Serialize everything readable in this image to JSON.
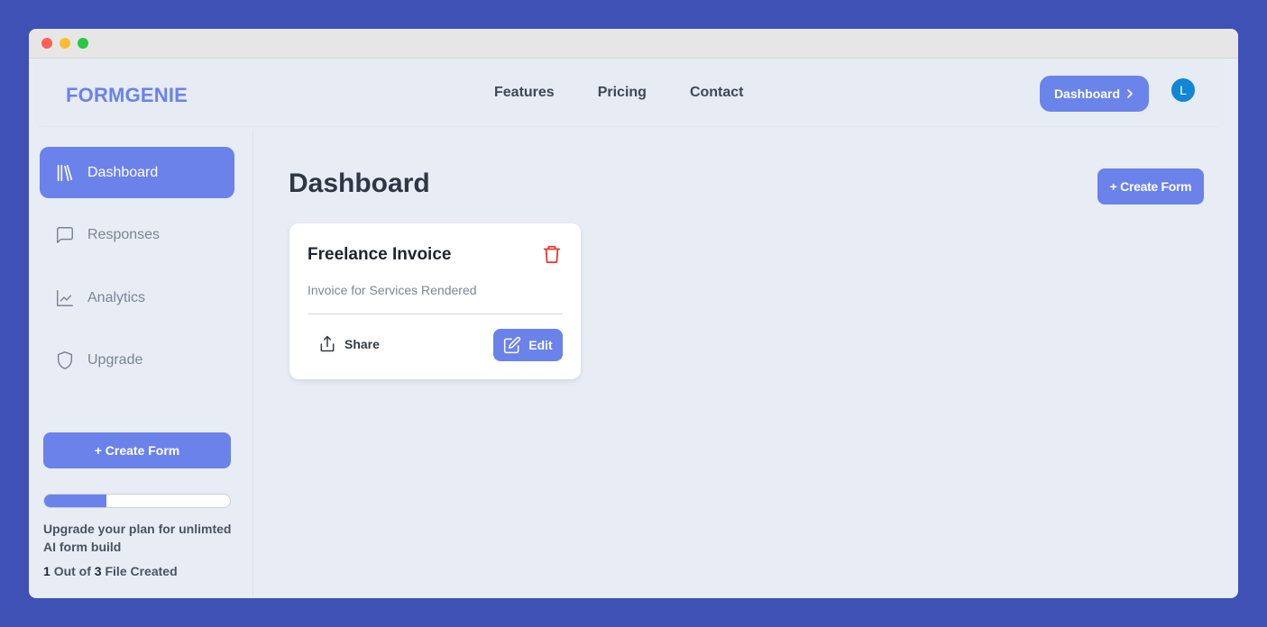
{
  "navbar": {
    "logo": "FORMGENIE",
    "links": [
      "Features",
      "Pricing",
      "Contact"
    ],
    "dashboard_button": "Dashboard",
    "avatar_initial": "L"
  },
  "sidebar": {
    "items": [
      {
        "label": "Dashboard",
        "icon": "library-icon",
        "active": true
      },
      {
        "label": "Responses",
        "icon": "message-square-icon",
        "active": false
      },
      {
        "label": "Analytics",
        "icon": "line-chart-icon",
        "active": false
      },
      {
        "label": "Upgrade",
        "icon": "shield-icon",
        "active": false
      }
    ],
    "create_button": "+ Create Form",
    "progress_fraction": 0.333,
    "upgrade_text": "Upgrade your plan for unlimted AI form build",
    "file_count": {
      "created": "1",
      "middle": "Out of",
      "total": "3",
      "suffix": "File Created"
    }
  },
  "main": {
    "title": "Dashboard",
    "create_button": "+ Create Form",
    "forms": [
      {
        "title": "Freelance Invoice",
        "description": "Invoice for Services Rendered",
        "share_label": "Share",
        "edit_label": "Edit"
      }
    ]
  },
  "colors": {
    "accent": "#6b82ea",
    "background": "#3f51b5",
    "delete": "#e53935"
  }
}
